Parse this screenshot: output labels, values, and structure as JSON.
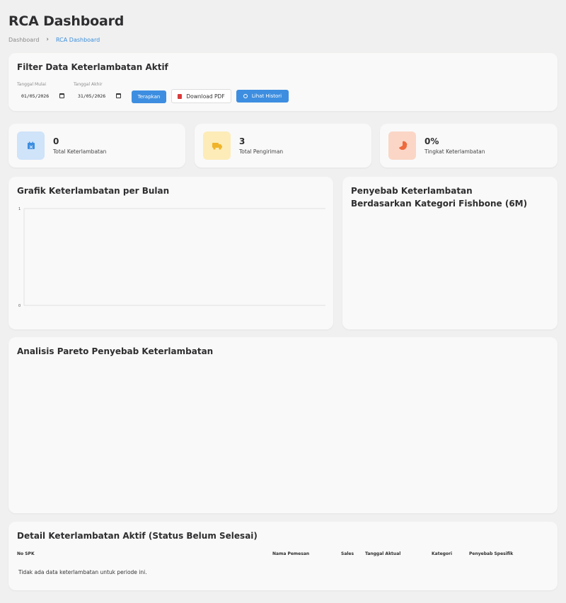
{
  "page": {
    "title": "RCA Dashboard",
    "breadcrumb": {
      "parent": "Dashboard",
      "separator": "›",
      "current": "RCA Dashboard"
    }
  },
  "filter": {
    "title": "Filter Data Keterlambatan Aktif",
    "start_label": "Tanggal Mulai",
    "start_value": "01/05/2026",
    "end_label": "Tanggal Akhir",
    "end_value": "31/05/2026",
    "apply_label": "Terapkan",
    "pdf_label": "Download PDF",
    "history_label": "Lihat Histori"
  },
  "stats": [
    {
      "value": "0",
      "label": "Total Keterlambatan",
      "icon": "calendar-x-icon",
      "color": "#3d8ee0"
    },
    {
      "value": "3",
      "label": "Total Pengiriman",
      "icon": "truck-icon",
      "color": "#f0b429"
    },
    {
      "value": "0%",
      "label": "Tingkat Keterlambatan",
      "icon": "pie-chart-icon",
      "color": "#ee6a3c"
    }
  ],
  "charts": {
    "monthly_title": "Grafik Keterlambatan per Bulan",
    "fishbone_title": "Penyebab Keterlambatan Berdasarkan Kategori Fishbone (6M)",
    "pareto_title": "Analisis Pareto Penyebab Keterlambatan"
  },
  "chart_data": {
    "type": "bar",
    "categories": [],
    "series": [],
    "ylim": [
      0,
      1
    ],
    "y_ticks": [
      "0",
      "1"
    ],
    "grid": true
  },
  "detail": {
    "title": "Detail Keterlambatan Aktif (Status Belum Selesai)",
    "columns": [
      "No SPK",
      "Nama Pemesan",
      "Sales",
      "Tanggal Aktual",
      "Kategori",
      "Penyebab Spesifik"
    ],
    "empty_message": "Tidak ada data keterlambatan untuk periode ini."
  },
  "colors": {
    "accent": "#3d8ee0",
    "background": "#f0f0f1",
    "card": "#f9f9f9"
  }
}
